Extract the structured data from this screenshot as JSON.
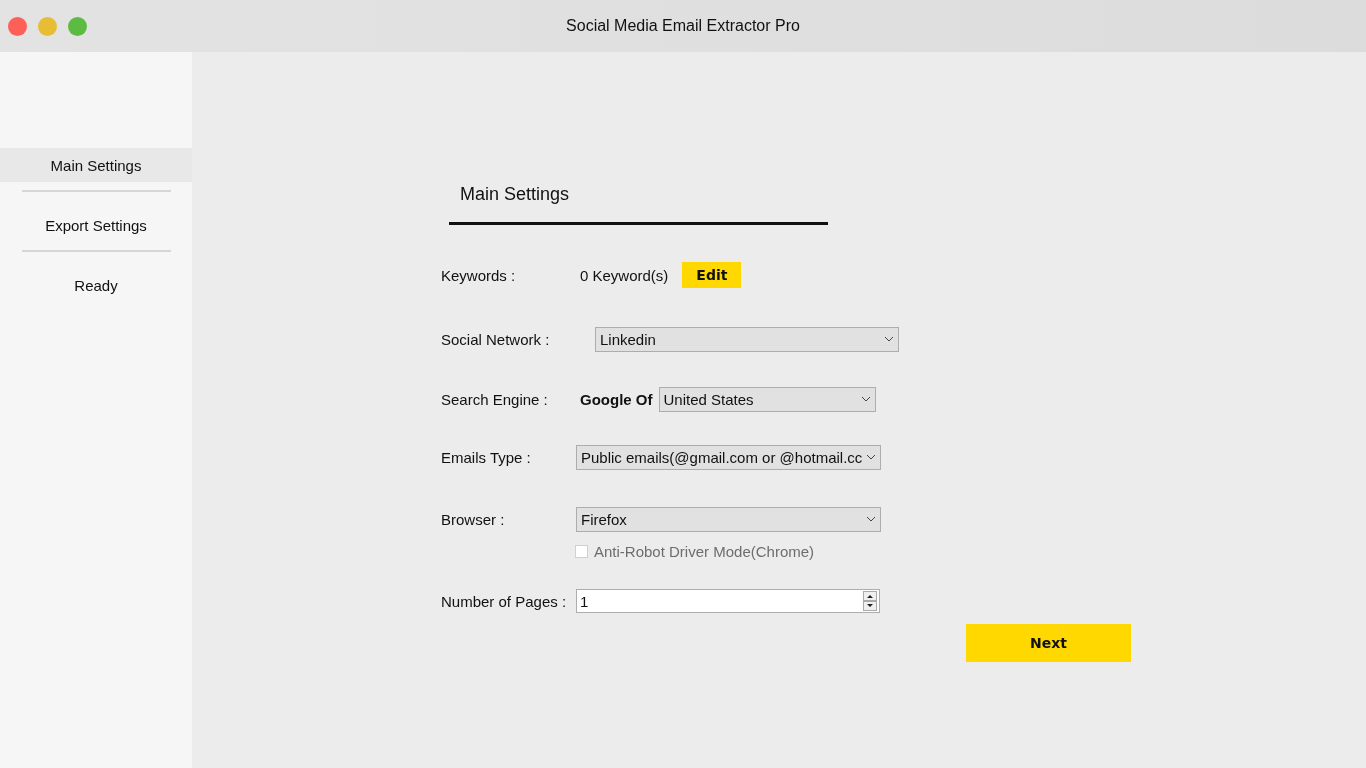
{
  "window": {
    "title": "Social Media Email Extractor Pro"
  },
  "sidebar": {
    "items": [
      {
        "label": "Main Settings",
        "selected": true
      },
      {
        "label": "Export Settings",
        "selected": false
      },
      {
        "label": "Ready",
        "selected": false
      }
    ]
  },
  "form": {
    "heading": "Main Settings",
    "rows": [
      {
        "kind": "keywords",
        "label": "Keywords :",
        "value": "0 Keyword(s)",
        "button": "Edit"
      },
      {
        "kind": "wide_select",
        "label": "Social Network :",
        "value": "Linkedin"
      },
      {
        "kind": "engine_select",
        "label": "Search Engine :",
        "prefix": "Google Of",
        "value": "United States"
      },
      {
        "kind": "select",
        "label": "Emails Type :",
        "value": "Public emails(@gmail.com or @hotmail.cc"
      },
      {
        "kind": "select",
        "label": "Browser :",
        "value": "Firefox"
      },
      {
        "kind": "checkbox",
        "label": "Anti-Robot Driver Mode(Chrome)",
        "checked": false,
        "disabled": true
      },
      {
        "kind": "number",
        "label": "Number of Pages :",
        "value": "1"
      }
    ],
    "next_button": "Next"
  }
}
